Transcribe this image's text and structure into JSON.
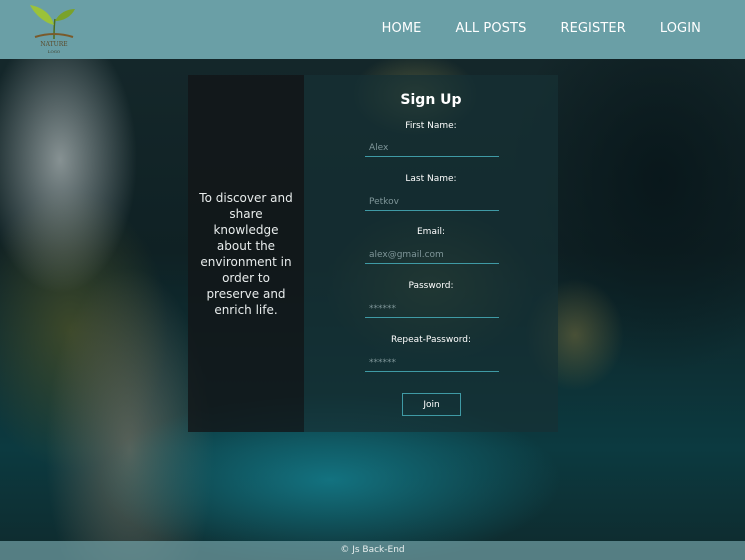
{
  "header": {
    "logo": {
      "title": "NATURE",
      "subtitle": "LOGO"
    },
    "nav": [
      {
        "label": "HOME"
      },
      {
        "label": "ALL POSTS"
      },
      {
        "label": "REGISTER"
      },
      {
        "label": "LOGIN"
      }
    ]
  },
  "intro": {
    "tagline": "To discover and share knowledge about the environment in order to preserve and enrich life."
  },
  "form": {
    "title": "Sign Up",
    "fields": [
      {
        "label": "First Name:",
        "placeholder": "Alex"
      },
      {
        "label": "Last Name:",
        "placeholder": "Petkov"
      },
      {
        "label": "Email:",
        "placeholder": "alex@gmail.com"
      },
      {
        "label": "Password:",
        "placeholder": "******"
      },
      {
        "label": "Repeat-Password:",
        "placeholder": "******"
      }
    ],
    "submit_label": "Join"
  },
  "footer": {
    "text": "© Js Back-End"
  },
  "colors": {
    "header_bg": "#6a9fa6",
    "accent_border": "#3f9aa5"
  },
  "icons": {
    "logo": "sprout-leaf-icon"
  }
}
